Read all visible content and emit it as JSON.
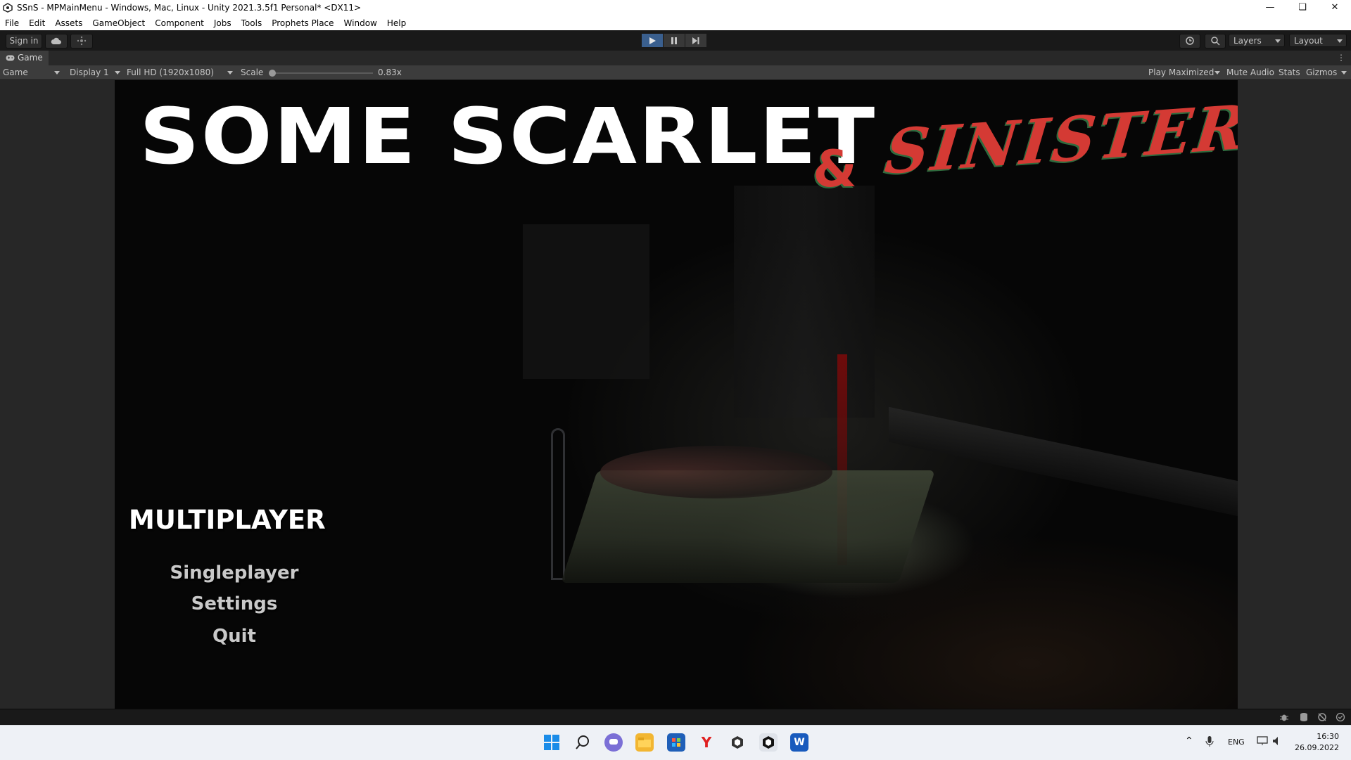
{
  "window": {
    "title": "SSnS - MPMainMenu - Windows, Mac, Linux - Unity 2021.3.5f1 Personal* <DX11>"
  },
  "menubar": [
    "File",
    "Edit",
    "Assets",
    "GameObject",
    "Component",
    "Jobs",
    "Tools",
    "Prophets Place",
    "Window",
    "Help"
  ],
  "toolbar": {
    "sign_in": "Sign in",
    "layers": "Layers",
    "layout": "Layout"
  },
  "tab": {
    "label": "Game"
  },
  "gamebar": {
    "view_mode": "Game",
    "display": "Display 1",
    "resolution": "Full HD (1920x1080)",
    "scale_label": "Scale",
    "scale_value": "0.83x",
    "scale_fraction": 0.0,
    "play_maximized": "Play Maximized",
    "mute_audio": "Mute Audio",
    "stats": "Stats",
    "gizmos": "Gizmos"
  },
  "game": {
    "title_main": "SOME SCARLET",
    "title_amp": "&",
    "title_accent": "SINISTER",
    "menu": {
      "multiplayer": "MULTIPLAYER",
      "singleplayer": "Singleplayer",
      "settings": "Settings",
      "quit": "Quit"
    }
  },
  "taskbar": {
    "lang": "ENG",
    "time": "16:30",
    "date": "26.09.2022"
  },
  "colors": {
    "accent_red": "#d43a34",
    "play_active": "#3a5f8e"
  }
}
